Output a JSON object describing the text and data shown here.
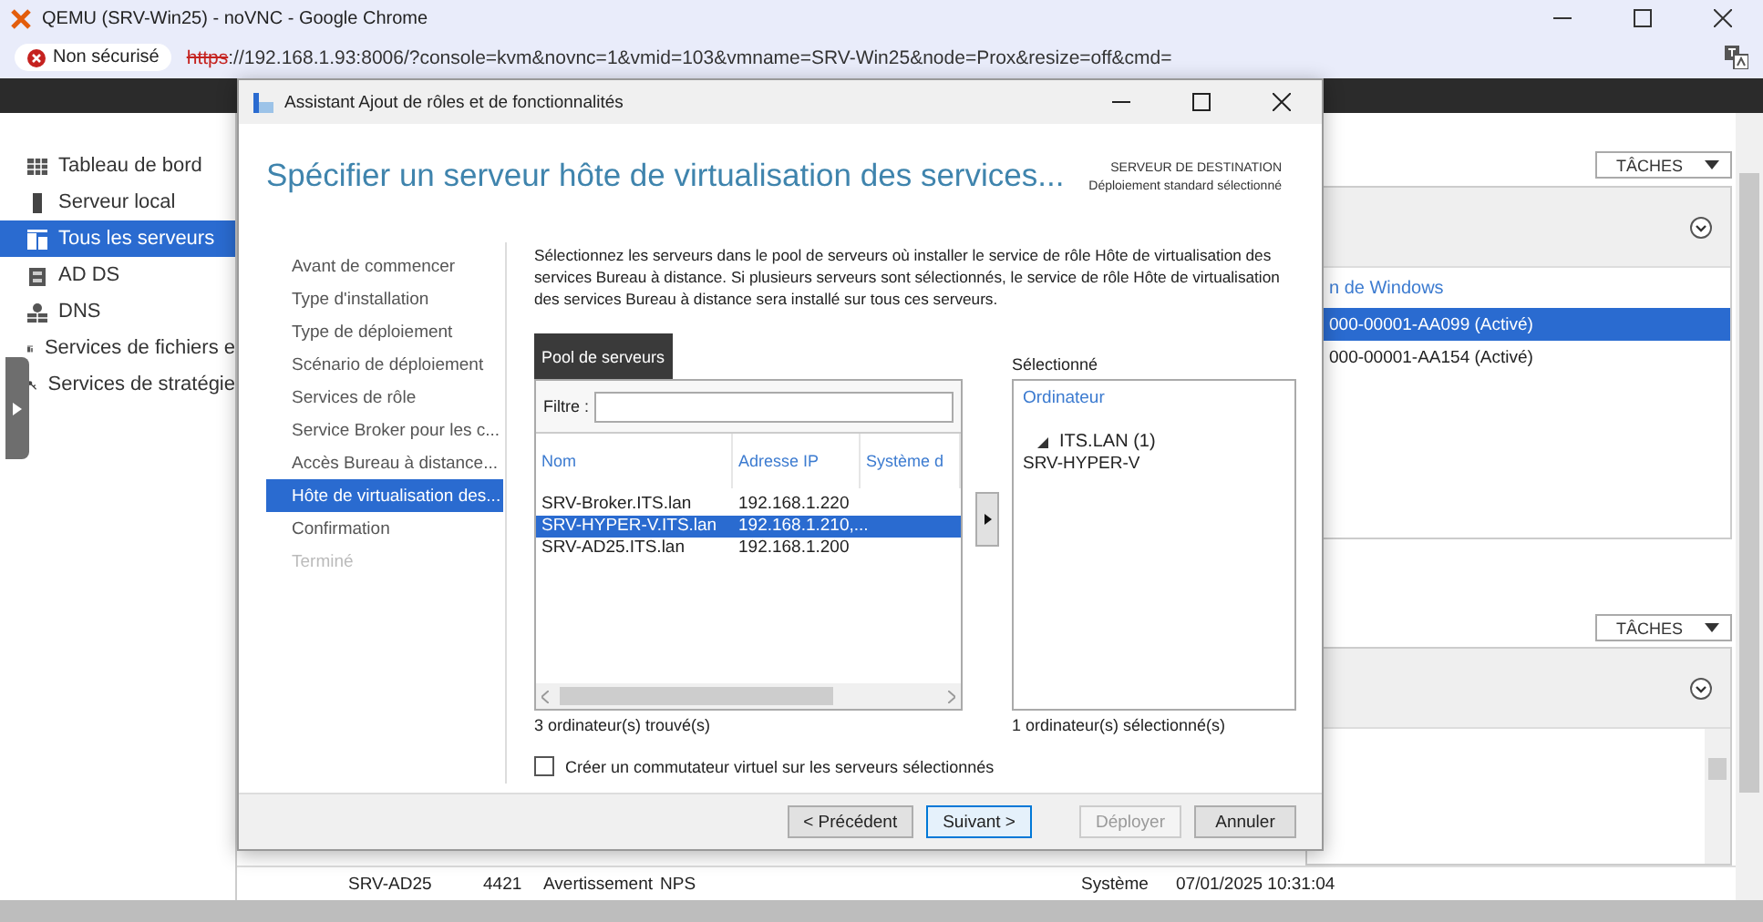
{
  "browser": {
    "title": "QEMU (SRV-Win25) - noVNC - Google Chrome",
    "security_label": "Non sécurisé",
    "url_scheme": "https",
    "url_rest": "://192.168.1.93:8006/?console=kvm&novnc=1&vmid=103&vmname=SRV-Win25&node=Prox&resize=off&cmd="
  },
  "server_manager": {
    "sidebar": [
      {
        "label": "Tableau de bord",
        "selected": false
      },
      {
        "label": "Serveur local",
        "selected": false
      },
      {
        "label": "Tous les serveurs",
        "selected": true
      },
      {
        "label": "AD DS",
        "selected": false
      },
      {
        "label": "DNS",
        "selected": false
      },
      {
        "label": "Services de fichiers e",
        "selected": false
      },
      {
        "label": "Services de stratégie",
        "selected": false
      }
    ],
    "panels": [
      {
        "tasks_label": "TÂCHES",
        "column_header": "n de Windows",
        "rows": [
          {
            "text": "000-00001-AA099 (Activé)",
            "selected": true
          },
          {
            "text": "000-00001-AA154 (Activé)",
            "selected": false
          }
        ]
      },
      {
        "tasks_label": "TÂCHES"
      }
    ],
    "event_row": [
      "SRV-AD25",
      "4421",
      "Avertissement",
      "NPS",
      "Système",
      "07/01/2025 10:31:04"
    ]
  },
  "dialog": {
    "title": "Assistant Ajout de rôles et de fonctionnalités",
    "heading": "Spécifier un serveur hôte de virtualisation des services...",
    "destination_label": "SERVEUR DE DESTINATION",
    "destination_value": "Déploiement standard sélectionné",
    "steps": [
      {
        "label": "Avant de commencer",
        "selected": false,
        "disabled": false
      },
      {
        "label": "Type d'installation",
        "selected": false,
        "disabled": false
      },
      {
        "label": "Type de déploiement",
        "selected": false,
        "disabled": false
      },
      {
        "label": "Scénario de déploiement",
        "selected": false,
        "disabled": false
      },
      {
        "label": "Services de rôle",
        "selected": false,
        "disabled": false
      },
      {
        "label": "Service Broker pour les c...",
        "selected": false,
        "disabled": false
      },
      {
        "label": "Accès Bureau à distance...",
        "selected": false,
        "disabled": false
      },
      {
        "label": "Hôte de virtualisation des...",
        "selected": true,
        "disabled": false
      },
      {
        "label": "Confirmation",
        "selected": false,
        "disabled": false
      },
      {
        "label": "Terminé",
        "selected": false,
        "disabled": true
      }
    ],
    "description": "Sélectionnez les serveurs dans le pool de serveurs où installer le service de rôle Hôte de virtualisation des services Bureau à distance. Si plusieurs serveurs sont sélectionnés, le service de rôle Hôte de virtualisation des services Bureau à distance sera installé sur tous ces serveurs.",
    "pool": {
      "tab": "Pool de serveurs",
      "filter_label": "Filtre :",
      "columns": [
        "Nom",
        "Adresse IP",
        "Système d"
      ],
      "rows": [
        {
          "name": "SRV-Broker.ITS.lan",
          "ip": "192.168.1.220",
          "selected": false
        },
        {
          "name": "SRV-HYPER-V.ITS.lan",
          "ip": "192.168.1.210,...",
          "selected": true
        },
        {
          "name": "SRV-AD25.ITS.lan",
          "ip": "192.168.1.200",
          "selected": false
        }
      ],
      "count": "3 ordinateur(s) trouvé(s)"
    },
    "selected_list": {
      "label": "Sélectionné",
      "column": "Ordinateur",
      "tree": [
        {
          "label": "ITS.LAN (1)",
          "expanded": true,
          "children": [
            {
              "label": "SRV-HYPER-V"
            }
          ]
        }
      ],
      "count": "1 ordinateur(s) sélectionné(s)"
    },
    "virtual_switch": {
      "label": "Créer un commutateur virtuel sur les serveurs sélectionnés",
      "checked": false
    },
    "buttons": [
      {
        "label": "< Précédent",
        "disabled": false,
        "focused": false
      },
      {
        "label": "Suivant >",
        "disabled": false,
        "focused": true
      },
      {
        "label": "Déployer",
        "disabled": true,
        "focused": false
      },
      {
        "label": "Annuler",
        "disabled": false,
        "focused": false
      }
    ]
  }
}
